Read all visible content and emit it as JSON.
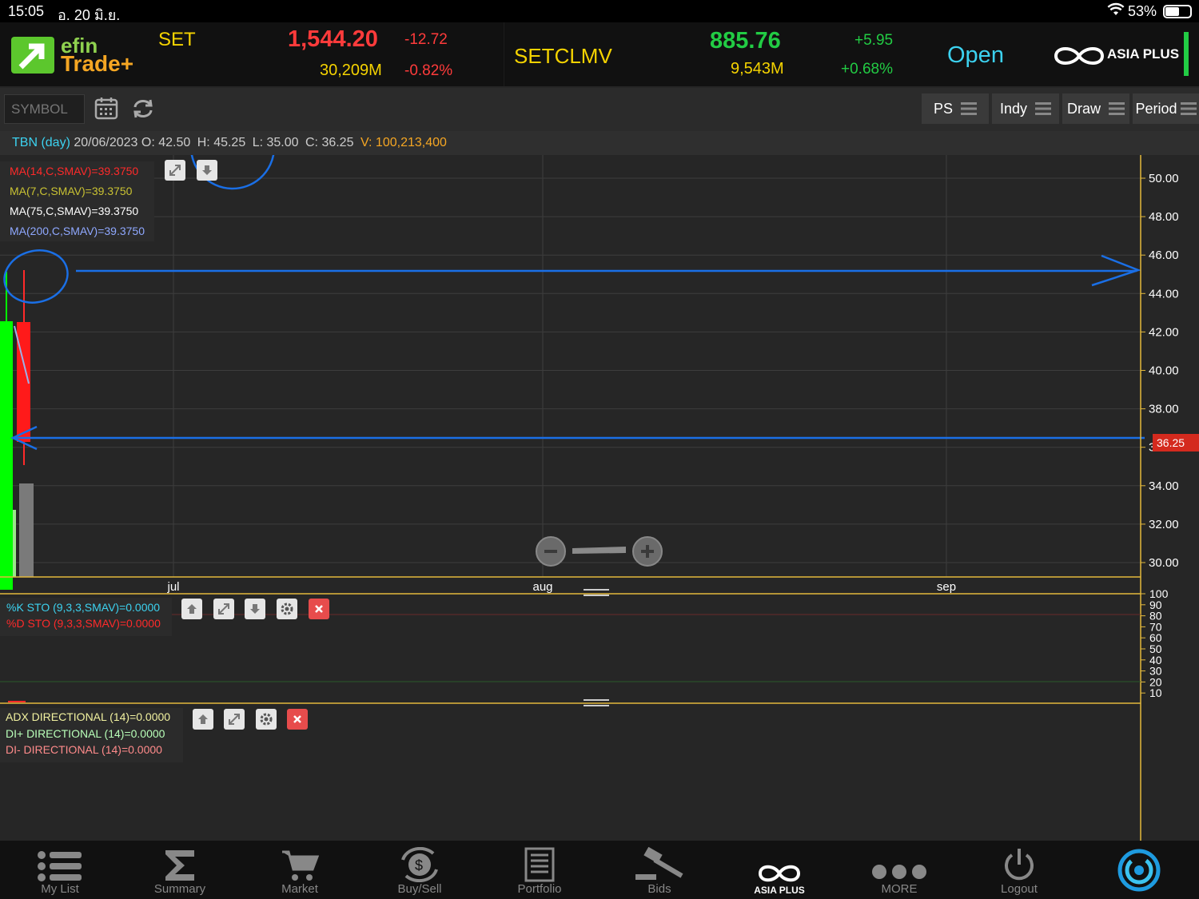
{
  "status_bar": {
    "time": "15:05",
    "date": "อ. 20 มิ.ย.",
    "battery": "53%"
  },
  "header": {
    "logo_top": "efin",
    "logo_bottom": "Trade+",
    "index1": {
      "name": "SET",
      "value": "1,544.20",
      "change": "-12.72",
      "volume": "30,209M",
      "pct": "-0.82%"
    },
    "index2": {
      "name": "SETCLMV",
      "value": "885.76",
      "change": "+5.95",
      "volume": "9,543M",
      "pct": "+0.68%"
    },
    "market_status": "Open",
    "broker": "ASIA PLUS",
    "colors": {
      "down": "#ff3b3b",
      "up": "#22cc44",
      "accent": "#f5d300",
      "open": "#3cd2f0"
    }
  },
  "toolbar": {
    "symbol_placeholder": "SYMBOL",
    "buttons": {
      "ps": "PS",
      "indy": "Indy",
      "draw": "Draw",
      "period": "Period"
    }
  },
  "ohlc": {
    "symbol": "TBN (day)",
    "date": "20/06/2023",
    "o_label": "O:",
    "o": "42.50",
    "h_label": "H:",
    "h": "45.25",
    "l_label": "L:",
    "l": "35.00",
    "c_label": "C:",
    "c": "36.25",
    "v_label": "V:",
    "v": "100,213,400"
  },
  "ma_legend": [
    {
      "text": "MA(14,C,SMAV)=39.3750",
      "color": "#ff2a2a"
    },
    {
      "text": "MA(7,C,SMAV)=39.3750",
      "color": "#c9c233"
    },
    {
      "text": "MA(75,C,SMAV)=39.3750",
      "color": "#ffffff"
    },
    {
      "text": "MA(200,C,SMAV)=39.3750",
      "color": "#8fa8ff"
    }
  ],
  "chart_data": {
    "type": "candlestick",
    "y_ticks": [
      "50.00",
      "48.00",
      "46.00",
      "44.00",
      "42.00",
      "40.00",
      "38.00",
      "36.00",
      "34.00",
      "32.00",
      "30.00"
    ],
    "x_ticks": [
      "jul",
      "aug",
      "sep"
    ],
    "last_price": "36.25",
    "candles": [
      {
        "date": "20/06/2023",
        "open": 42.5,
        "high": 45.25,
        "low": 35.0,
        "close": 36.25,
        "volume": 100213400
      }
    ]
  },
  "sto_legend": [
    {
      "text": "%K STO (9,3,3,SMAV)=0.0000",
      "color": "#3cd2f0"
    },
    {
      "text": "%D STO (9,3,3,SMAV)=0.0000",
      "color": "#ff2a2a"
    }
  ],
  "sto_ticks": [
    "100",
    "90",
    "80",
    "70",
    "60",
    "50",
    "40",
    "30",
    "20",
    "10"
  ],
  "adx_legend": [
    {
      "text": "ADX DIRECTIONAL (14)=0.0000",
      "color": "#f2f2a0"
    },
    {
      "text": "DI+ DIRECTIONAL (14)=0.0000",
      "color": "#b8ffb8"
    },
    {
      "text": "DI- DIRECTIONAL (14)=0.0000",
      "color": "#ff8b8b"
    }
  ],
  "tabs": [
    "My List",
    "Summary",
    "Market",
    "Buy/Sell",
    "Portfolio",
    "Bids",
    "ASIA PLUS",
    "MORE",
    "Logout"
  ]
}
